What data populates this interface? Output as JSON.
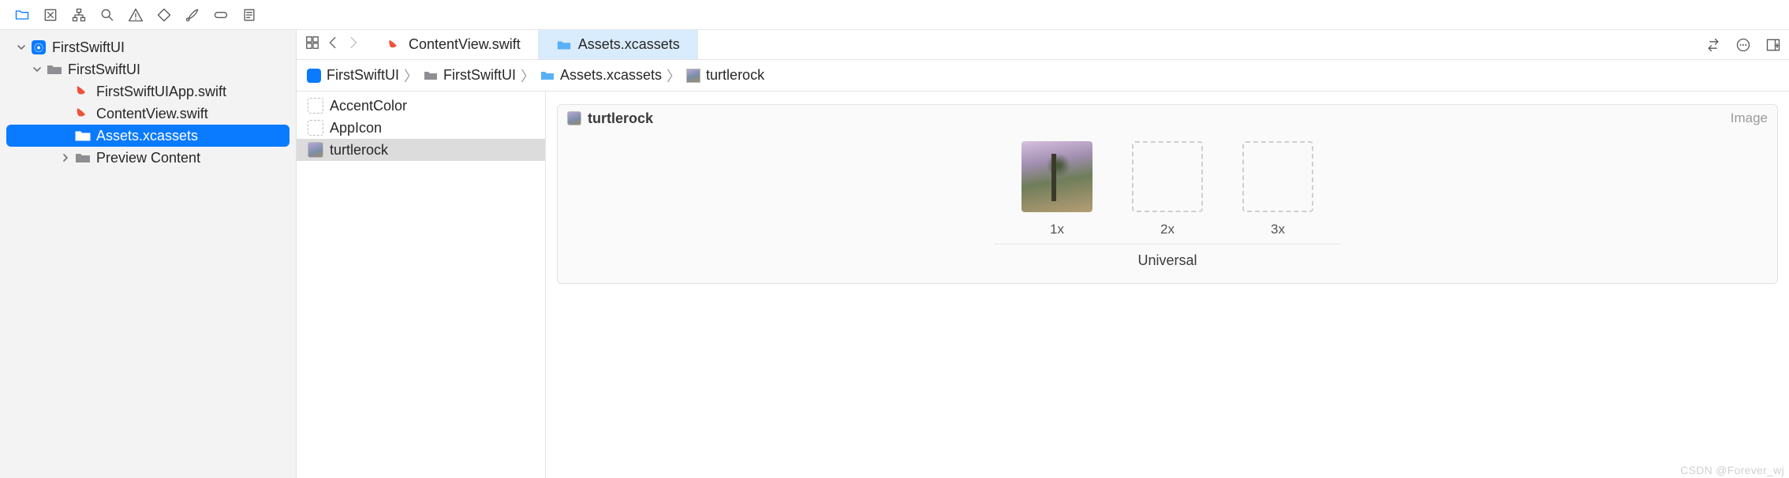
{
  "toolbar": {
    "icons": [
      "folder",
      "box-x",
      "hierarchy",
      "search",
      "warning",
      "diamond",
      "brush",
      "pill",
      "notes"
    ],
    "right_icons": [
      "swap",
      "ellipsis",
      "add-panel"
    ]
  },
  "sidebar": {
    "items": [
      {
        "label": "FirstSwiftUI",
        "icon": "app-icon",
        "indent": 0,
        "expanded": true
      },
      {
        "label": "FirstSwiftUI",
        "icon": "folder-icon",
        "indent": 1,
        "expanded": true
      },
      {
        "label": "FirstSwiftUIApp.swift",
        "icon": "swift-icon",
        "indent": 2
      },
      {
        "label": "ContentView.swift",
        "icon": "swift-icon",
        "indent": 2
      },
      {
        "label": "Assets.xcassets",
        "icon": "assets-icon",
        "indent": 2,
        "selected": true
      },
      {
        "label": "Preview Content",
        "icon": "folder-icon",
        "indent": 2,
        "expandable": true
      }
    ]
  },
  "tabs": [
    {
      "label": "ContentView.swift",
      "icon": "swift-icon"
    },
    {
      "label": "Assets.xcassets",
      "icon": "assets-icon",
      "active": true
    }
  ],
  "jumpbar": [
    {
      "label": "FirstSwiftUI",
      "icon": "app-icon"
    },
    {
      "label": "FirstSwiftUI",
      "icon": "folder-icon"
    },
    {
      "label": "Assets.xcassets",
      "icon": "assets-icon"
    },
    {
      "label": "turtlerock",
      "icon": "image-icon"
    }
  ],
  "asset_list": [
    {
      "label": "AccentColor",
      "thumb": "empty"
    },
    {
      "label": "AppIcon",
      "thumb": "empty"
    },
    {
      "label": "turtlerock",
      "thumb": "img",
      "selected": true
    }
  ],
  "imageset": {
    "title": "turtlerock",
    "kind": "Image",
    "slots": [
      {
        "label": "1x",
        "has_image": true
      },
      {
        "label": "2x",
        "has_image": false
      },
      {
        "label": "3x",
        "has_image": false
      }
    ],
    "group_label": "Universal"
  },
  "watermark": "CSDN @Forever_wj"
}
